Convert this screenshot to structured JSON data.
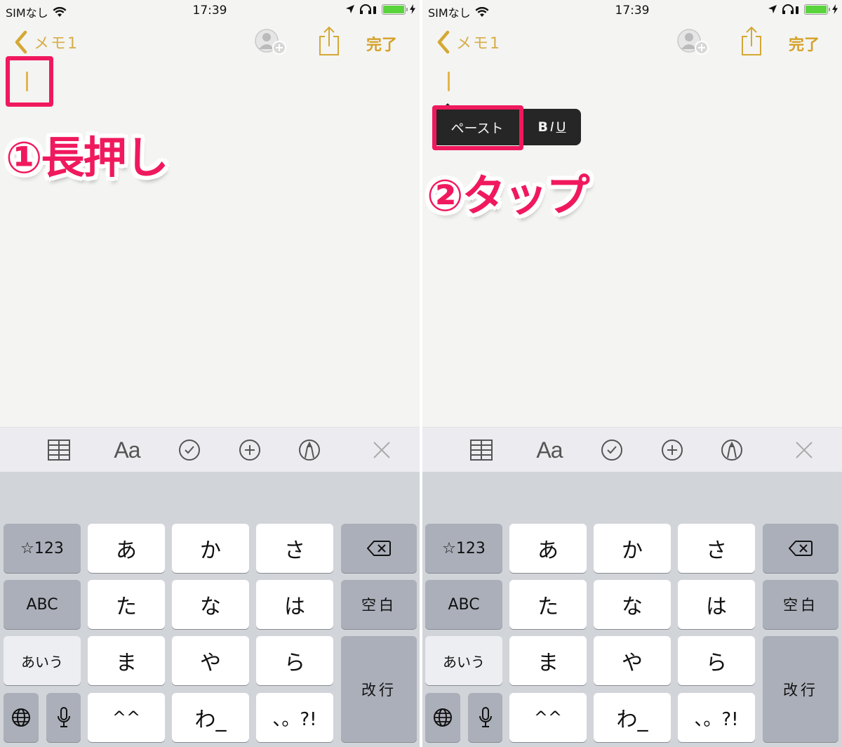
{
  "colors": {
    "accent": "#d4a12a",
    "annotation": "#f0195e",
    "caret": "#e4b54a",
    "menu_bg": "#262626",
    "keyboard_bg": "#d1d4d9",
    "key_white": "#ffffff",
    "key_gray": "#abafb9",
    "toolbar_bg": "#ececf0",
    "battery": "#5ad43c"
  },
  "panels": [
    {
      "status": {
        "carrier": "SIMなし",
        "time": "17:39",
        "battery_level_percent": 100
      },
      "nav": {
        "back_label": "メモ1",
        "done_label": "完了"
      },
      "annotation": {
        "step_label": "①長押し"
      }
    },
    {
      "status": {
        "carrier": "SIMなし",
        "time": "17:39",
        "battery_level_percent": 100
      },
      "nav": {
        "back_label": "メモ1",
        "done_label": "完了"
      },
      "edit_menu": {
        "paste_label": "ペースト",
        "bold": "B",
        "italic": "I",
        "underline": "U"
      },
      "annotation": {
        "step_label": "②タップ"
      }
    }
  ],
  "toolbar": {
    "icons": [
      "table-icon",
      "text-format-icon",
      "checklist-icon",
      "add-icon",
      "markup-icon",
      "close-icon"
    ],
    "text_format_label": "Aa"
  },
  "keyboard": {
    "num_key": "☆123",
    "abc_key": "ABC",
    "kana_mode_key": "あいう",
    "row1": [
      "あ",
      "か",
      "さ"
    ],
    "row2": [
      "た",
      "な",
      "は"
    ],
    "row3": [
      "ま",
      "や",
      "ら"
    ],
    "row4": [
      "^^",
      "わ_",
      "、。?!"
    ],
    "space_key": "空白",
    "return_key": "改行"
  }
}
